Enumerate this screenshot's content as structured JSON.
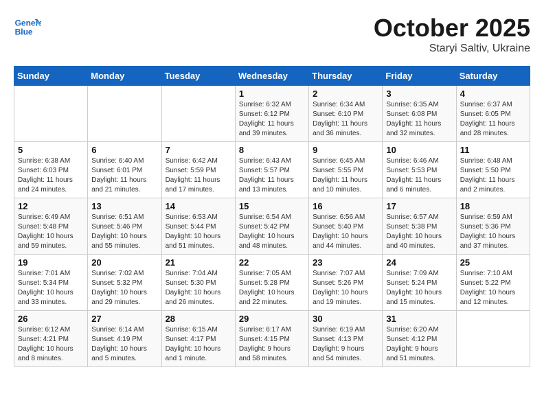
{
  "header": {
    "logo_line1": "General",
    "logo_line2": "Blue",
    "month": "October 2025",
    "location": "Staryi Saltiv, Ukraine"
  },
  "days_of_week": [
    "Sunday",
    "Monday",
    "Tuesday",
    "Wednesday",
    "Thursday",
    "Friday",
    "Saturday"
  ],
  "weeks": [
    [
      {
        "day": "",
        "info": ""
      },
      {
        "day": "",
        "info": ""
      },
      {
        "day": "",
        "info": ""
      },
      {
        "day": "1",
        "info": "Sunrise: 6:32 AM\nSunset: 6:12 PM\nDaylight: 11 hours\nand 39 minutes."
      },
      {
        "day": "2",
        "info": "Sunrise: 6:34 AM\nSunset: 6:10 PM\nDaylight: 11 hours\nand 36 minutes."
      },
      {
        "day": "3",
        "info": "Sunrise: 6:35 AM\nSunset: 6:08 PM\nDaylight: 11 hours\nand 32 minutes."
      },
      {
        "day": "4",
        "info": "Sunrise: 6:37 AM\nSunset: 6:05 PM\nDaylight: 11 hours\nand 28 minutes."
      }
    ],
    [
      {
        "day": "5",
        "info": "Sunrise: 6:38 AM\nSunset: 6:03 PM\nDaylight: 11 hours\nand 24 minutes."
      },
      {
        "day": "6",
        "info": "Sunrise: 6:40 AM\nSunset: 6:01 PM\nDaylight: 11 hours\nand 21 minutes."
      },
      {
        "day": "7",
        "info": "Sunrise: 6:42 AM\nSunset: 5:59 PM\nDaylight: 11 hours\nand 17 minutes."
      },
      {
        "day": "8",
        "info": "Sunrise: 6:43 AM\nSunset: 5:57 PM\nDaylight: 11 hours\nand 13 minutes."
      },
      {
        "day": "9",
        "info": "Sunrise: 6:45 AM\nSunset: 5:55 PM\nDaylight: 11 hours\nand 10 minutes."
      },
      {
        "day": "10",
        "info": "Sunrise: 6:46 AM\nSunset: 5:53 PM\nDaylight: 11 hours\nand 6 minutes."
      },
      {
        "day": "11",
        "info": "Sunrise: 6:48 AM\nSunset: 5:50 PM\nDaylight: 11 hours\nand 2 minutes."
      }
    ],
    [
      {
        "day": "12",
        "info": "Sunrise: 6:49 AM\nSunset: 5:48 PM\nDaylight: 10 hours\nand 59 minutes."
      },
      {
        "day": "13",
        "info": "Sunrise: 6:51 AM\nSunset: 5:46 PM\nDaylight: 10 hours\nand 55 minutes."
      },
      {
        "day": "14",
        "info": "Sunrise: 6:53 AM\nSunset: 5:44 PM\nDaylight: 10 hours\nand 51 minutes."
      },
      {
        "day": "15",
        "info": "Sunrise: 6:54 AM\nSunset: 5:42 PM\nDaylight: 10 hours\nand 48 minutes."
      },
      {
        "day": "16",
        "info": "Sunrise: 6:56 AM\nSunset: 5:40 PM\nDaylight: 10 hours\nand 44 minutes."
      },
      {
        "day": "17",
        "info": "Sunrise: 6:57 AM\nSunset: 5:38 PM\nDaylight: 10 hours\nand 40 minutes."
      },
      {
        "day": "18",
        "info": "Sunrise: 6:59 AM\nSunset: 5:36 PM\nDaylight: 10 hours\nand 37 minutes."
      }
    ],
    [
      {
        "day": "19",
        "info": "Sunrise: 7:01 AM\nSunset: 5:34 PM\nDaylight: 10 hours\nand 33 minutes."
      },
      {
        "day": "20",
        "info": "Sunrise: 7:02 AM\nSunset: 5:32 PM\nDaylight: 10 hours\nand 29 minutes."
      },
      {
        "day": "21",
        "info": "Sunrise: 7:04 AM\nSunset: 5:30 PM\nDaylight: 10 hours\nand 26 minutes."
      },
      {
        "day": "22",
        "info": "Sunrise: 7:05 AM\nSunset: 5:28 PM\nDaylight: 10 hours\nand 22 minutes."
      },
      {
        "day": "23",
        "info": "Sunrise: 7:07 AM\nSunset: 5:26 PM\nDaylight: 10 hours\nand 19 minutes."
      },
      {
        "day": "24",
        "info": "Sunrise: 7:09 AM\nSunset: 5:24 PM\nDaylight: 10 hours\nand 15 minutes."
      },
      {
        "day": "25",
        "info": "Sunrise: 7:10 AM\nSunset: 5:22 PM\nDaylight: 10 hours\nand 12 minutes."
      }
    ],
    [
      {
        "day": "26",
        "info": "Sunrise: 6:12 AM\nSunset: 4:21 PM\nDaylight: 10 hours\nand 8 minutes."
      },
      {
        "day": "27",
        "info": "Sunrise: 6:14 AM\nSunset: 4:19 PM\nDaylight: 10 hours\nand 5 minutes."
      },
      {
        "day": "28",
        "info": "Sunrise: 6:15 AM\nSunset: 4:17 PM\nDaylight: 10 hours\nand 1 minute."
      },
      {
        "day": "29",
        "info": "Sunrise: 6:17 AM\nSunset: 4:15 PM\nDaylight: 9 hours\nand 58 minutes."
      },
      {
        "day": "30",
        "info": "Sunrise: 6:19 AM\nSunset: 4:13 PM\nDaylight: 9 hours\nand 54 minutes."
      },
      {
        "day": "31",
        "info": "Sunrise: 6:20 AM\nSunset: 4:12 PM\nDaylight: 9 hours\nand 51 minutes."
      },
      {
        "day": "",
        "info": ""
      }
    ]
  ]
}
